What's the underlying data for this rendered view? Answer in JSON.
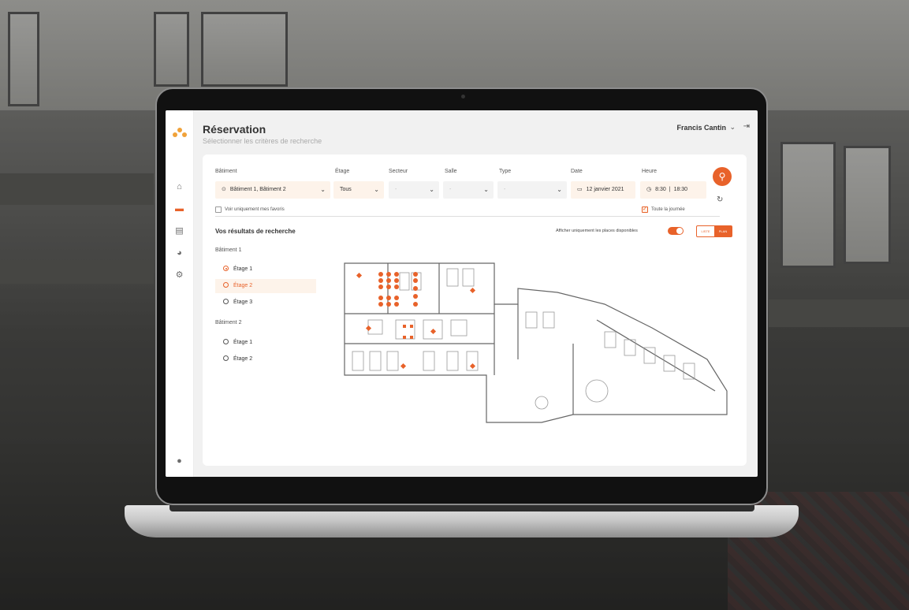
{
  "app": {
    "title": "Réservation",
    "subtitle": "Sélectionner les critères de recherche",
    "user_name": "Francis Cantin"
  },
  "filters": {
    "building": {
      "label": "Bâtiment",
      "value": "Bâtiment 1, Bâtiment 2"
    },
    "floor": {
      "label": "Étage",
      "value": "Tous"
    },
    "sector": {
      "label": "Secteur",
      "value": "-"
    },
    "room": {
      "label": "Salle",
      "value": "-"
    },
    "type": {
      "label": "Type",
      "value": "-"
    },
    "date": {
      "label": "Date",
      "value": "12 janvier 2021"
    },
    "time": {
      "label": "Heure",
      "start": "8:30",
      "end": "18:30"
    },
    "favorites_only_label": "Voir uniquement mes favoris",
    "all_day_label": "Toute la journée",
    "all_day_checked": true
  },
  "results": {
    "title": "Vos résultats de recherche",
    "available_only_label": "Afficher uniquement les places disponibles",
    "available_only_on": true,
    "view_list_label": "LISTE",
    "view_map_label": "PLAN",
    "buildings": [
      {
        "name": "Bâtiment 1",
        "floors": [
          "Étage 1",
          "Étage 2",
          "Étage 3"
        ]
      },
      {
        "name": "Bâtiment 2",
        "floors": [
          "Étage 1",
          "Étage 2"
        ]
      }
    ],
    "selected_floor": "Bâtiment 1 / Étage 2",
    "checked_floor": "Bâtiment 1 / Étage 1"
  },
  "colors": {
    "accent": "#e8622a",
    "accent_light": "#fdf3ea",
    "logo": "#f0a23a"
  },
  "icons": {
    "nav": [
      "home-icon",
      "calendar-icon",
      "calendar-check-icon",
      "chart-pie-icon",
      "gear-icon",
      "user-icon"
    ],
    "search": "search-icon",
    "reset": "reset-icon",
    "logout": "logout-icon"
  }
}
